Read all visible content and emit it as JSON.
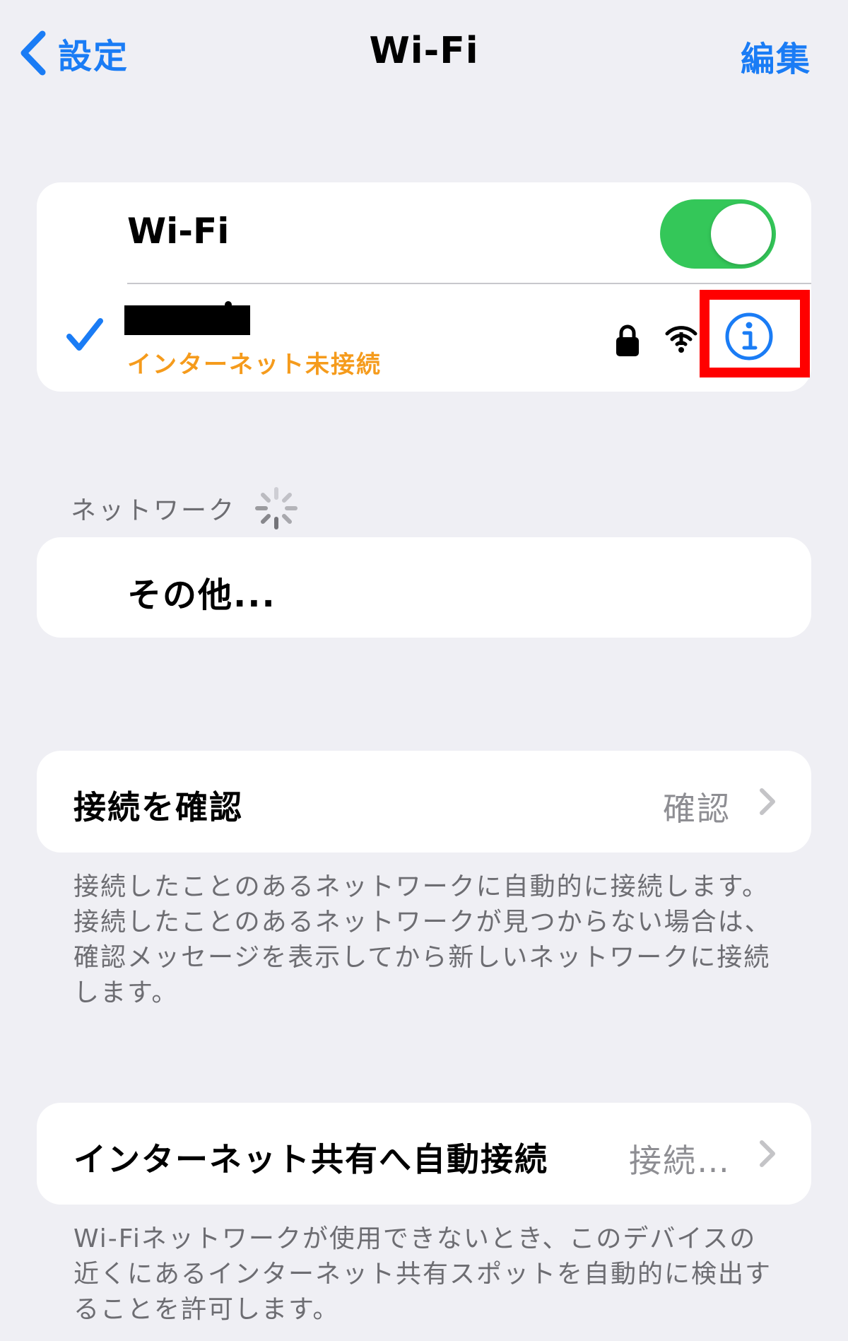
{
  "nav": {
    "back_label": "設定",
    "title": "Wi-Fi",
    "edit_label": "編集"
  },
  "wifi": {
    "label": "Wi-Fi",
    "toggle_on": true,
    "connected_network": {
      "status": "インターネット未接続"
    }
  },
  "networks": {
    "header": "ネットワーク",
    "other_label": "その他..."
  },
  "ask_to_join": {
    "label": "接続を確認",
    "value": "確認",
    "footer": "接続したことのあるネットワークに自動的に接続します。接続したことのあるネットワークが見つからない場合は、確認メッセージを表示してから新しいネットワークに接続します。"
  },
  "auto_hotspot": {
    "label": "インターネット共有へ自動接続",
    "value": "接続…",
    "footer": "Wi-Fiネットワークが使用できないとき、このデバイスの近くにあるインターネット共有スポットを自動的に検出することを許可します。"
  },
  "colors": {
    "accent": "#1a7cf5",
    "toggle_on": "#34c759",
    "warning": "#f59b1c",
    "highlight": "#ff0000",
    "background": "#efeff4"
  },
  "icons": {
    "back": "chevron-left-icon",
    "check": "checkmark-icon",
    "lock": "lock-icon",
    "signal": "wifi-signal-icon",
    "info": "info-circle-icon",
    "spinner": "loading-spinner-icon",
    "disclosure": "chevron-right-icon"
  }
}
